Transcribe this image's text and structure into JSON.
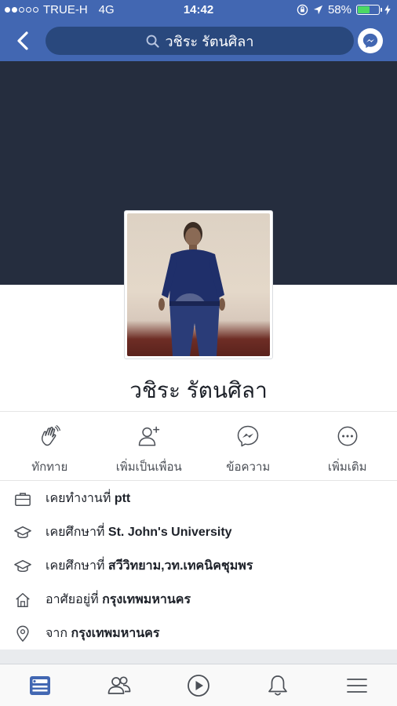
{
  "status_bar": {
    "carrier": "TRUE-H",
    "network": "4G",
    "time": "14:42",
    "battery_percent": "58%",
    "battery_level": 0.58,
    "signal_bars": 2
  },
  "nav": {
    "search_text": "วชิระ รัตนศิลา"
  },
  "colors": {
    "brand_blue": "#4267b2",
    "search_field": "#29487d",
    "cover": "#252d3e",
    "battery_green": "#4cd964"
  },
  "profile": {
    "name": "วชิระ รัตนศิลา"
  },
  "actions": [
    {
      "label": "ทักทาย",
      "icon": "wave-hand-icon"
    },
    {
      "label": "เพิ่มเป็นเพื่อน",
      "icon": "add-friend-icon"
    },
    {
      "label": "ข้อความ",
      "icon": "messenger-icon"
    },
    {
      "label": "เพิ่มเติม",
      "icon": "more-icon"
    }
  ],
  "info": [
    {
      "icon": "briefcase-icon",
      "prefix": "เคยทำงานที่ ",
      "value": "ptt"
    },
    {
      "icon": "graduation-cap-icon",
      "prefix": "เคยศึกษาที่ ",
      "value": "St. John's University"
    },
    {
      "icon": "graduation-cap-icon",
      "prefix": "เคยศึกษาที่ ",
      "value": "สวีวิทยาม,วท.เทคนิคชุมพร"
    },
    {
      "icon": "home-icon",
      "prefix": "อาศัยอยู่ที่ ",
      "value": "กรุงเทพมหานคร"
    },
    {
      "icon": "location-pin-icon",
      "prefix": "จาก ",
      "value": "กรุงเทพมหานคร"
    }
  ],
  "tabs": [
    {
      "name": "news-feed-tab",
      "icon": "news-feed-icon",
      "active": true
    },
    {
      "name": "friends-tab",
      "icon": "friends-icon",
      "active": false
    },
    {
      "name": "watch-tab",
      "icon": "play-icon",
      "active": false
    },
    {
      "name": "notifications-tab",
      "icon": "bell-icon",
      "active": false
    },
    {
      "name": "menu-tab",
      "icon": "hamburger-menu-icon",
      "active": false
    }
  ]
}
